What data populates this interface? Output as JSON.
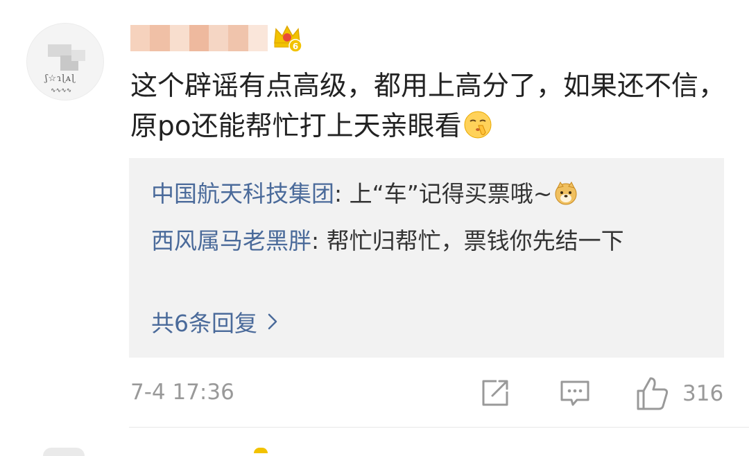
{
  "comment": {
    "text": "这个辟谣有点高级，都用上高分了，如果还不信，原po还能帮忙打上天亲眼看",
    "emoji": "shush-face-icon",
    "timestamp": "7-4 17:36",
    "like_count": "316",
    "badge_level": "6"
  },
  "replies": [
    {
      "author": "中国航天科技集团",
      "separator": ": ",
      "text": "上“车”记得买票哦~"
    },
    {
      "author": "西风属马老黑胖",
      "separator": ": ",
      "text": "帮忙归帮忙，票钱你先结一下"
    }
  ],
  "more_replies": "共6条回复",
  "colors": {
    "link": "#4a6a9a",
    "text": "#222222",
    "muted": "#999999",
    "reply_bg": "#f2f2f2",
    "badge": "#f2c200"
  }
}
